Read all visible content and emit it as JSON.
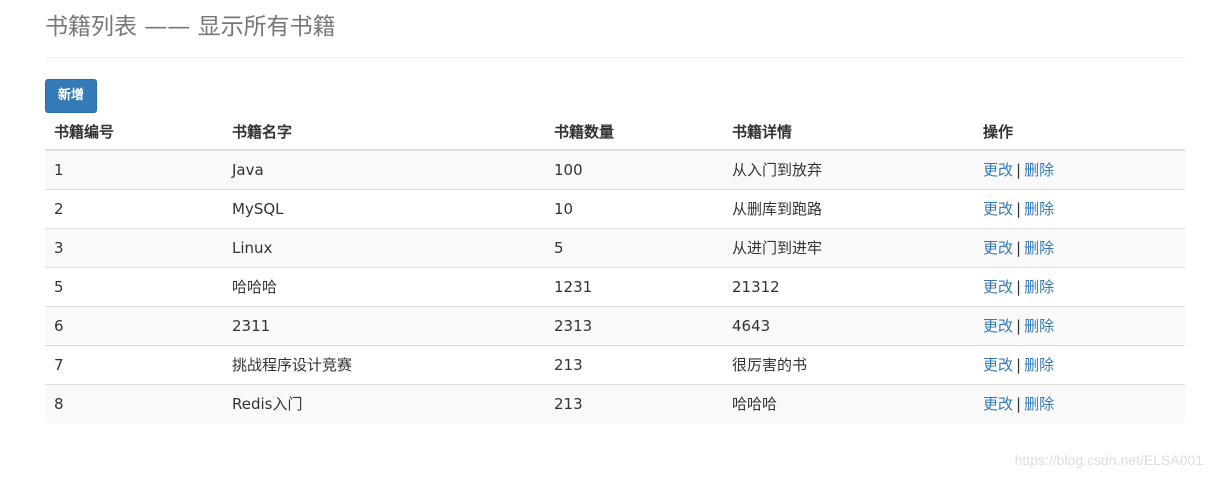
{
  "header": {
    "title": "书籍列表 —— 显示所有书籍"
  },
  "toolbar": {
    "add_label": "新增"
  },
  "table": {
    "columns": [
      "书籍编号",
      "书籍名字",
      "书籍数量",
      "书籍详情",
      "操作"
    ],
    "rows": [
      {
        "id": "1",
        "name": "Java",
        "count": "100",
        "detail": "从入门到放弃"
      },
      {
        "id": "2",
        "name": "MySQL",
        "count": "10",
        "detail": "从删库到跑路"
      },
      {
        "id": "3",
        "name": "Linux",
        "count": "5",
        "detail": "从进门到进牢"
      },
      {
        "id": "5",
        "name": "哈哈哈",
        "count": "1231",
        "detail": "21312"
      },
      {
        "id": "6",
        "name": "2311",
        "count": "2313",
        "detail": "4643"
      },
      {
        "id": "7",
        "name": "挑战程序设计竞赛",
        "count": "213",
        "detail": "很厉害的书"
      },
      {
        "id": "8",
        "name": "Redis入门",
        "count": "213",
        "detail": "哈哈哈"
      }
    ],
    "actions": {
      "edit_label": "更改",
      "separator": "|",
      "delete_label": "删除"
    }
  },
  "watermark": "https://blog.csdn.net/ELSA001",
  "colors": {
    "primary": "#337ab7",
    "title": "#777777",
    "text": "#333333",
    "stripe": "#f9f9f9",
    "border": "#dddddd"
  }
}
